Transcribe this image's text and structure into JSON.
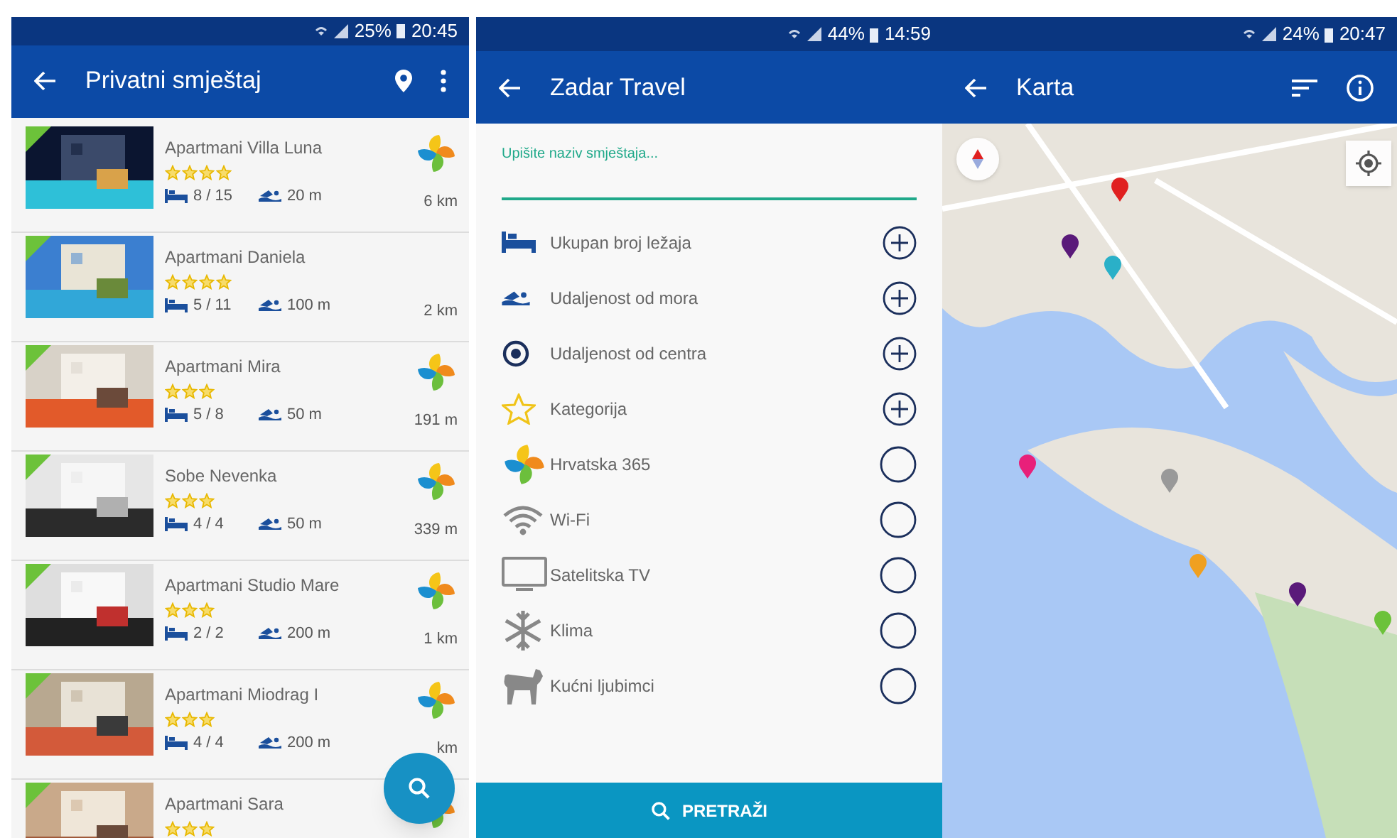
{
  "screens": [
    {
      "status": {
        "battery": "25%",
        "time": "20:45"
      },
      "title": "Privatni smještaj",
      "listings": [
        {
          "name": "Apartmani Villa Luna",
          "stars": 4,
          "beds": "8 / 15",
          "sea": "20 m",
          "distance": "6 km",
          "certified": true
        },
        {
          "name": "Apartmani Daniela",
          "stars": 4,
          "beds": "5 / 11",
          "sea": "100 m",
          "distance": "2 km",
          "certified": false
        },
        {
          "name": "Apartmani Mira",
          "stars": 3,
          "beds": "5 / 8",
          "sea": "50 m",
          "distance": "191 m",
          "certified": true
        },
        {
          "name": "Sobe Nevenka",
          "stars": 3,
          "beds": "4 / 4",
          "sea": "50 m",
          "distance": "339 m",
          "certified": true
        },
        {
          "name": "Apartmani Studio Mare",
          "stars": 3,
          "beds": "2 / 2",
          "sea": "200 m",
          "distance": "1 km",
          "certified": true
        },
        {
          "name": "Apartmani Miodrag I",
          "stars": 3,
          "beds": "4 / 4",
          "sea": "200 m",
          "distance": "km",
          "certified": true
        },
        {
          "name": "Apartmani Sara",
          "stars": 3,
          "certified": true
        }
      ]
    },
    {
      "status": {
        "battery": "44%",
        "time": "14:59"
      },
      "title": "Zadar Travel",
      "search": {
        "label": "Upišite naziv smještaja..."
      },
      "filters": [
        {
          "label": "Ukupan broj ležaja",
          "kind": "range"
        },
        {
          "label": "Udaljenost od mora",
          "kind": "range"
        },
        {
          "label": "Udaljenost od centra",
          "kind": "range"
        },
        {
          "label": "Kategorija",
          "kind": "range"
        },
        {
          "label": "Hrvatska 365",
          "kind": "toggle",
          "checked": false
        },
        {
          "label": "Wi-Fi",
          "kind": "toggle",
          "checked": false
        },
        {
          "label": "Satelitska TV",
          "kind": "toggle",
          "checked": false
        },
        {
          "label": "Klima",
          "kind": "toggle",
          "checked": false
        },
        {
          "label": "Kućni ljubimci",
          "kind": "toggle",
          "checked": false
        }
      ],
      "button": "PRETRAŽI"
    },
    {
      "status": {
        "battery": "24%",
        "time": "20:47"
      },
      "title": "Karta"
    }
  ]
}
